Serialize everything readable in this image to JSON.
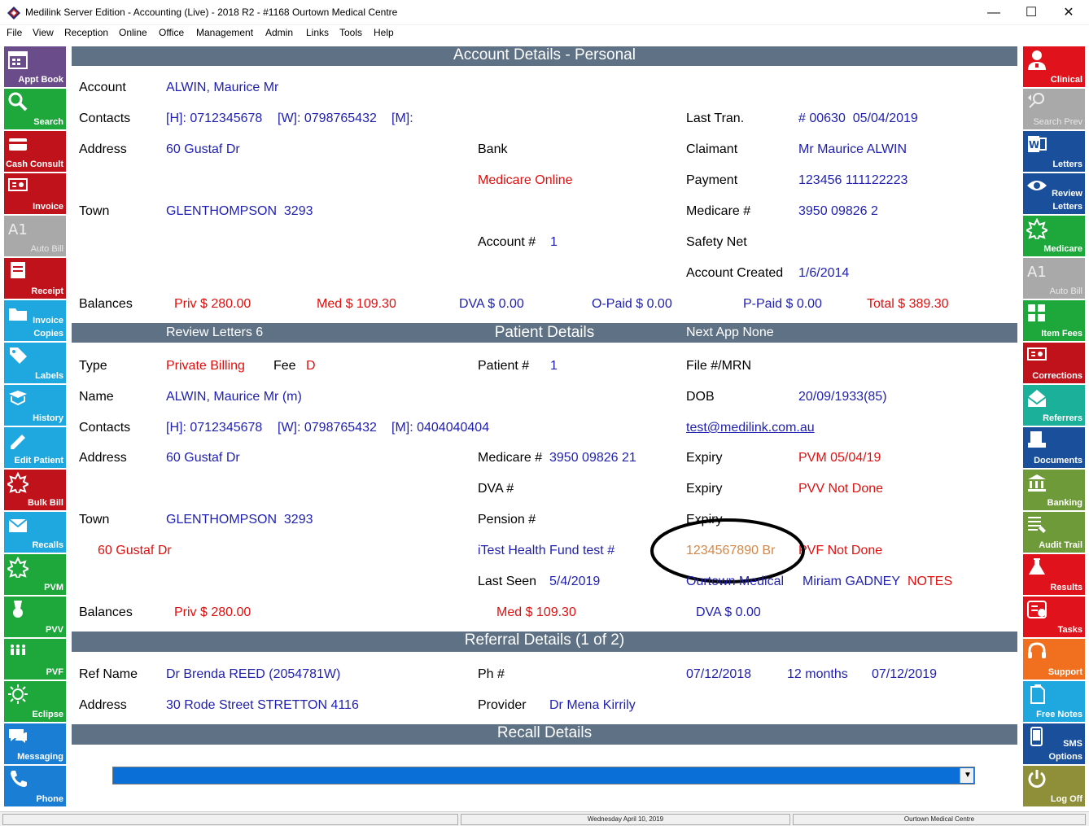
{
  "window": {
    "title": "Medilink Server Edition - Accounting (Live) - 2018 R2 - #1168 Ourtown Medical Centre",
    "minimize": "—",
    "maximize": "☐",
    "close": "✕"
  },
  "menu": [
    "File",
    "View",
    "Reception",
    "Online",
    "Office",
    "Management",
    "Admin",
    "Links",
    "Tools",
    "Help"
  ],
  "left_tiles": [
    {
      "label": "Appt Book",
      "color": "#6b4c8a",
      "icon": "calendar-icon"
    },
    {
      "label": "Search",
      "color": "#1ea83c",
      "icon": "magnifier-icon"
    },
    {
      "label": "Cash Consult",
      "color": "#c0121b",
      "icon": "card-icon"
    },
    {
      "label": "Invoice",
      "color": "#c0121b",
      "icon": "invoice-icon"
    },
    {
      "label": "Auto Bill",
      "color": "#a9a9a9",
      "icon": "autobill-icon"
    },
    {
      "label": "Receipt",
      "color": "#c0121b",
      "icon": "receipt-icon"
    },
    {
      "label": "Invoice\nCopies",
      "color": "#1fa8e0",
      "icon": "folder-icon"
    },
    {
      "label": "Labels",
      "color": "#1fa8e0",
      "icon": "tag-icon"
    },
    {
      "label": "History",
      "color": "#1fa8e0",
      "icon": "book-icon"
    },
    {
      "label": "Edit Patient",
      "color": "#1fa8e0",
      "icon": "pencil-icon"
    },
    {
      "label": "Bulk Bill",
      "color": "#c0121b",
      "icon": "medicare-star-icon"
    },
    {
      "label": "Recalls",
      "color": "#1fa8e0",
      "icon": "envelope-icon"
    },
    {
      "label": "PVM",
      "color": "#1ea83c",
      "icon": "medicare-star-icon"
    },
    {
      "label": "PVV",
      "color": "#1ea83c",
      "icon": "medal-icon"
    },
    {
      "label": "PVF",
      "color": "#1ea83c",
      "icon": "family-icon"
    },
    {
      "label": "Eclipse",
      "color": "#1ea83c",
      "icon": "sun-icon"
    },
    {
      "label": "Messaging",
      "color": "#1a7fd4",
      "icon": "chat-icon"
    },
    {
      "label": "Phone",
      "color": "#1a7fd4",
      "icon": "phone-icon"
    }
  ],
  "right_tiles": [
    {
      "label": "Clinical",
      "color": "#e0121b",
      "icon": "doctor-icon"
    },
    {
      "label": "Search Prev",
      "color": "#a9a9a9",
      "icon": "search-prev-icon"
    },
    {
      "label": "Letters",
      "color": "#1a4f9c",
      "icon": "word-icon"
    },
    {
      "label": "Review\nLetters",
      "color": "#1a4f9c",
      "icon": "eye-icon"
    },
    {
      "label": "Medicare",
      "color": "#1ea83c",
      "icon": "medicare-star-icon"
    },
    {
      "label": "Auto Bill",
      "color": "#a9a9a9",
      "icon": "autobill-icon"
    },
    {
      "label": "Item Fees",
      "color": "#1ea83c",
      "icon": "calculator-icon"
    },
    {
      "label": "Corrections",
      "color": "#c0121b",
      "icon": "invoice-icon"
    },
    {
      "label": "Referrers",
      "color": "#1ab09a",
      "icon": "envelope-open-icon"
    },
    {
      "label": "Documents",
      "color": "#1a4f9c",
      "icon": "scanner-icon"
    },
    {
      "label": "Banking",
      "color": "#6f9a3a",
      "icon": "bank-icon"
    },
    {
      "label": "Audit Trail",
      "color": "#6f9a3a",
      "icon": "list-icon"
    },
    {
      "label": "Results",
      "color": "#e0121b",
      "icon": "flask-icon"
    },
    {
      "label": "Tasks",
      "color": "#e0121b",
      "icon": "tasks-icon"
    },
    {
      "label": "Support",
      "color": "#f07020",
      "icon": "headset-icon"
    },
    {
      "label": "Free Notes",
      "color": "#1fa8e0",
      "icon": "note-icon"
    },
    {
      "label": "SMS\nOptions",
      "color": "#1a4f9c",
      "icon": "mobile-icon"
    },
    {
      "label": "Log Off",
      "color": "#8f8f3a",
      "icon": "power-icon"
    }
  ],
  "account": {
    "header": "Account Details - Personal",
    "account_label": "Account",
    "account_value": "ALWIN, Maurice Mr",
    "contacts_label": "Contacts",
    "contacts_h": "[H]: 0712345678",
    "contacts_w": "[W]: 0798765432",
    "contacts_m": "[M]:",
    "last_tran_label": "Last Tran.",
    "last_tran_value": "# 00630  05/04/2019",
    "address_label": "Address",
    "address_value": "60 Gustaf Dr",
    "bank_label": "Bank",
    "claimant_label": "Claimant",
    "claimant_value": "Mr Maurice ALWIN",
    "medicare_online": "Medicare Online",
    "payment_label": "Payment",
    "payment_value": "123456 111122223",
    "town_label": "Town",
    "town_value": "GLENTHOMPSON  3293",
    "medicare_label": "Medicare #",
    "medicare_value": "3950 09826 2",
    "account_no_label": "Account #",
    "account_no_value": "1",
    "safety_net_label": "Safety Net",
    "created_label": "Account Created",
    "created_value": "1/6/2014",
    "balances_label": "Balances",
    "priv": "Priv $ 280.00",
    "med": "Med $ 109.30",
    "dva": "DVA $ 0.00",
    "opaid": "O-Paid $ 0.00",
    "ppaid": "P-Paid $ 0.00",
    "total": "Total $ 389.30"
  },
  "patient": {
    "review_letters": "Review Letters 6",
    "header": "Patient Details",
    "next_app": "Next App None",
    "type_label": "Type",
    "type_value": "Private Billing",
    "fee_label": "Fee",
    "fee_value": "D",
    "patient_no_label": "Patient #",
    "patient_no_value": "1",
    "file_label": "File #/MRN",
    "name_label": "Name",
    "name_value": "ALWIN, Maurice Mr (m)",
    "dob_label": "DOB",
    "dob_value": "20/09/1933(85)",
    "contacts_label": "Contacts",
    "contacts_h": "[H]: 0712345678",
    "contacts_w": "[W]: 0798765432",
    "contacts_m": "[M]: 0404040404",
    "email": "test@medilink.com.au",
    "address_label": "Address",
    "address_value": "60 Gustaf Dr",
    "medicare_label": "Medicare #",
    "medicare_value": "3950 09826 21",
    "expiry_label": "Expiry",
    "pvm": "PVM 05/04/19",
    "dva_label": "DVA #",
    "pvv": "PVV Not Done",
    "town_label": "Town",
    "town_value": "GLENTHOMPSON  3293",
    "pension_label": "Pension #",
    "alt_address": "60 Gustaf Dr",
    "health_fund": "iTest Health Fund test #",
    "health_fund_no": "1234567890 Br",
    "pvf": "PVF Not Done",
    "last_seen_label": "Last Seen",
    "last_seen_value": "5/4/2019",
    "practice": "Ourtown Medical",
    "doctor": "Miriam GADNEY",
    "notes": "NOTES",
    "balances_label": "Balances",
    "priv": "Priv $ 280.00",
    "med": "Med $ 109.30",
    "dva": "DVA $ 0.00"
  },
  "referral": {
    "header": "Referral Details (1 of 2)",
    "ref_name_label": "Ref Name",
    "ref_name_value": "Dr Brenda REED (2054781W)",
    "ph_label": "Ph #",
    "date_from": "07/12/2018",
    "period": "12 months",
    "date_to": "07/12/2019",
    "address_label": "Address",
    "address_value": "30 Rode Street STRETTON 4116",
    "provider_label": "Provider",
    "provider_value": "Dr Mena Kirrily"
  },
  "recall": {
    "header": "Recall Details",
    "dropdown_arrow": "▼"
  },
  "status": {
    "date": "Wednesday April 10, 2019",
    "practice": "Ourtown Medical Centre"
  }
}
